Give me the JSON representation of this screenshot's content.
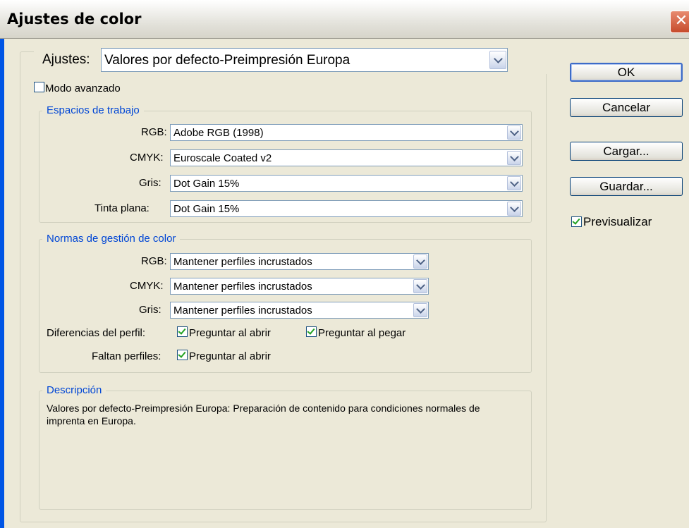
{
  "window": {
    "title": "Ajustes de color",
    "close_glyph": "✕"
  },
  "settings": {
    "label": "Ajustes:",
    "value": "Valores por defecto-Preimpresión Europa"
  },
  "advanced_mode": {
    "label": "Modo avanzado",
    "checked": false
  },
  "working_spaces": {
    "title": "Espacios de trabajo",
    "rows": [
      {
        "label": "RGB:",
        "value": "Adobe RGB (1998)"
      },
      {
        "label": "CMYK:",
        "value": "Euroscale Coated v2"
      },
      {
        "label": "Gris:",
        "value": "Dot Gain 15%"
      },
      {
        "label": "Tinta plana:",
        "value": "Dot Gain 15%"
      }
    ]
  },
  "policies": {
    "title": "Normas de gestión de color",
    "rows": [
      {
        "label": "RGB:",
        "value": "Mantener perfiles incrustados"
      },
      {
        "label": "CMYK:",
        "value": "Mantener perfiles incrustados"
      },
      {
        "label": "Gris:",
        "value": "Mantener perfiles incrustados"
      }
    ],
    "profile_mismatch": {
      "label": "Diferencias del perfil:",
      "ask_open": {
        "label": "Preguntar al abrir",
        "checked": true
      },
      "ask_paste": {
        "label": "Preguntar al pegar",
        "checked": true
      }
    },
    "missing_profiles": {
      "label": "Faltan perfiles:",
      "ask_open": {
        "label": "Preguntar al abrir",
        "checked": true
      }
    }
  },
  "description": {
    "title": "Descripción",
    "text": "Valores por defecto-Preimpresión Europa:  Preparación de contenido para condiciones normales de imprenta en Europa."
  },
  "buttons": {
    "ok": "OK",
    "cancel": "Cancelar",
    "load": "Cargar...",
    "save": "Guardar..."
  },
  "preview": {
    "label": "Previsualizar",
    "checked": true
  },
  "colors": {
    "accent_blue": "#0046d5",
    "dialog_bg": "#ece9d8",
    "check_green": "#21a121",
    "close_red": "#c64b2c"
  }
}
